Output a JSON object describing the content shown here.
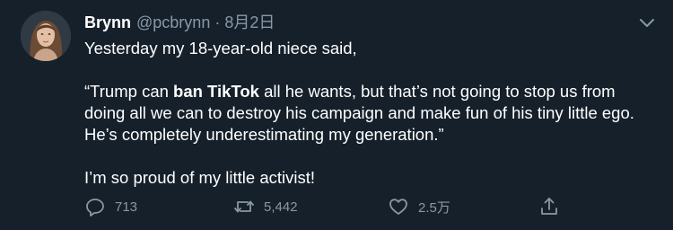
{
  "tweet": {
    "author_name": "Brynn",
    "handle": "@pcbrynn",
    "separator": "·",
    "date": "8月2日",
    "text": {
      "line1": "Yesterday my 18-year-old niece said,",
      "quote_prefix": "“Trump can ",
      "quote_bold": "ban TikTok",
      "quote_suffix": " all he wants, but that’s not going to stop us from doing all we can to destroy his campaign and make fun of his tiny little ego. He’s completely underestimating my generation.”",
      "closing": "I’m so proud of my little activist!"
    },
    "stats": {
      "replies": "713",
      "retweets": "5,442",
      "likes": "2.5万"
    },
    "icons": {
      "reply": "reply-icon",
      "retweet": "retweet-icon",
      "like": "heart-icon",
      "share": "share-icon",
      "more": "chevron-down-icon"
    },
    "colors": {
      "background": "#15202b",
      "text": "#ffffff",
      "secondary": "#8899a6"
    }
  }
}
